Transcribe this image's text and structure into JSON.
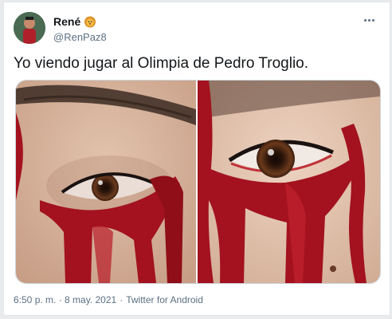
{
  "tweet": {
    "display_name": "René",
    "badge_icon": "lion-emoji-icon",
    "handle": "@RenPaz8",
    "text": "Yo viendo jugar al Olimpia de Pedro Troglio.",
    "media": [
      {
        "icon": "photo-eye-left"
      },
      {
        "icon": "photo-eye-right"
      }
    ],
    "timestamp": "6:50 p. m. · 8 may. 2021",
    "separator": "·",
    "source": "Twitter for Android"
  },
  "colors": {
    "name": "#14171a",
    "secondary": "#5b7083",
    "blood": "#a3121e"
  }
}
